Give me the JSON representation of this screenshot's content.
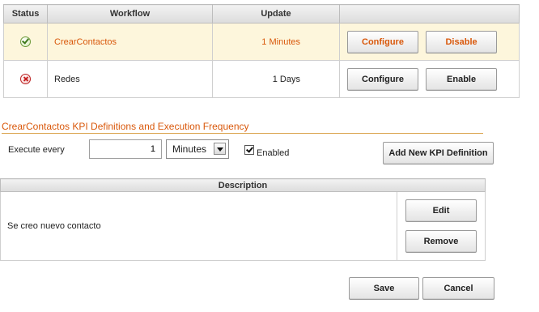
{
  "workflows": {
    "headers": {
      "status": "Status",
      "workflow": "Workflow",
      "update": "Update",
      "actions": ""
    },
    "rows": [
      {
        "status_icon": "ok-icon",
        "name": "CrearContactos",
        "update": "1 Minutes",
        "configure": "Configure",
        "toggle": "Disable",
        "active": true
      },
      {
        "status_icon": "error-icon",
        "name": "Redes",
        "update": "1 Days",
        "configure": "Configure",
        "toggle": "Enable",
        "active": false
      }
    ]
  },
  "kpi": {
    "title": "CrearContactos KPI Definitions and Execution Frequency",
    "execute_label": "Execute every",
    "execute_value": "1",
    "unit": "Minutes",
    "enabled_label": "Enabled",
    "enabled_checked": true,
    "add_button": "Add New KPI Definition",
    "table": {
      "header": "Description",
      "rows": [
        {
          "description": "Se creo nuevo contacto",
          "edit": "Edit",
          "remove": "Remove"
        }
      ]
    }
  },
  "footer": {
    "save": "Save",
    "cancel": "Cancel"
  },
  "colors": {
    "accent": "#d9580b",
    "highlight_row": "#fdf6dc",
    "rule": "#d9a24a"
  }
}
